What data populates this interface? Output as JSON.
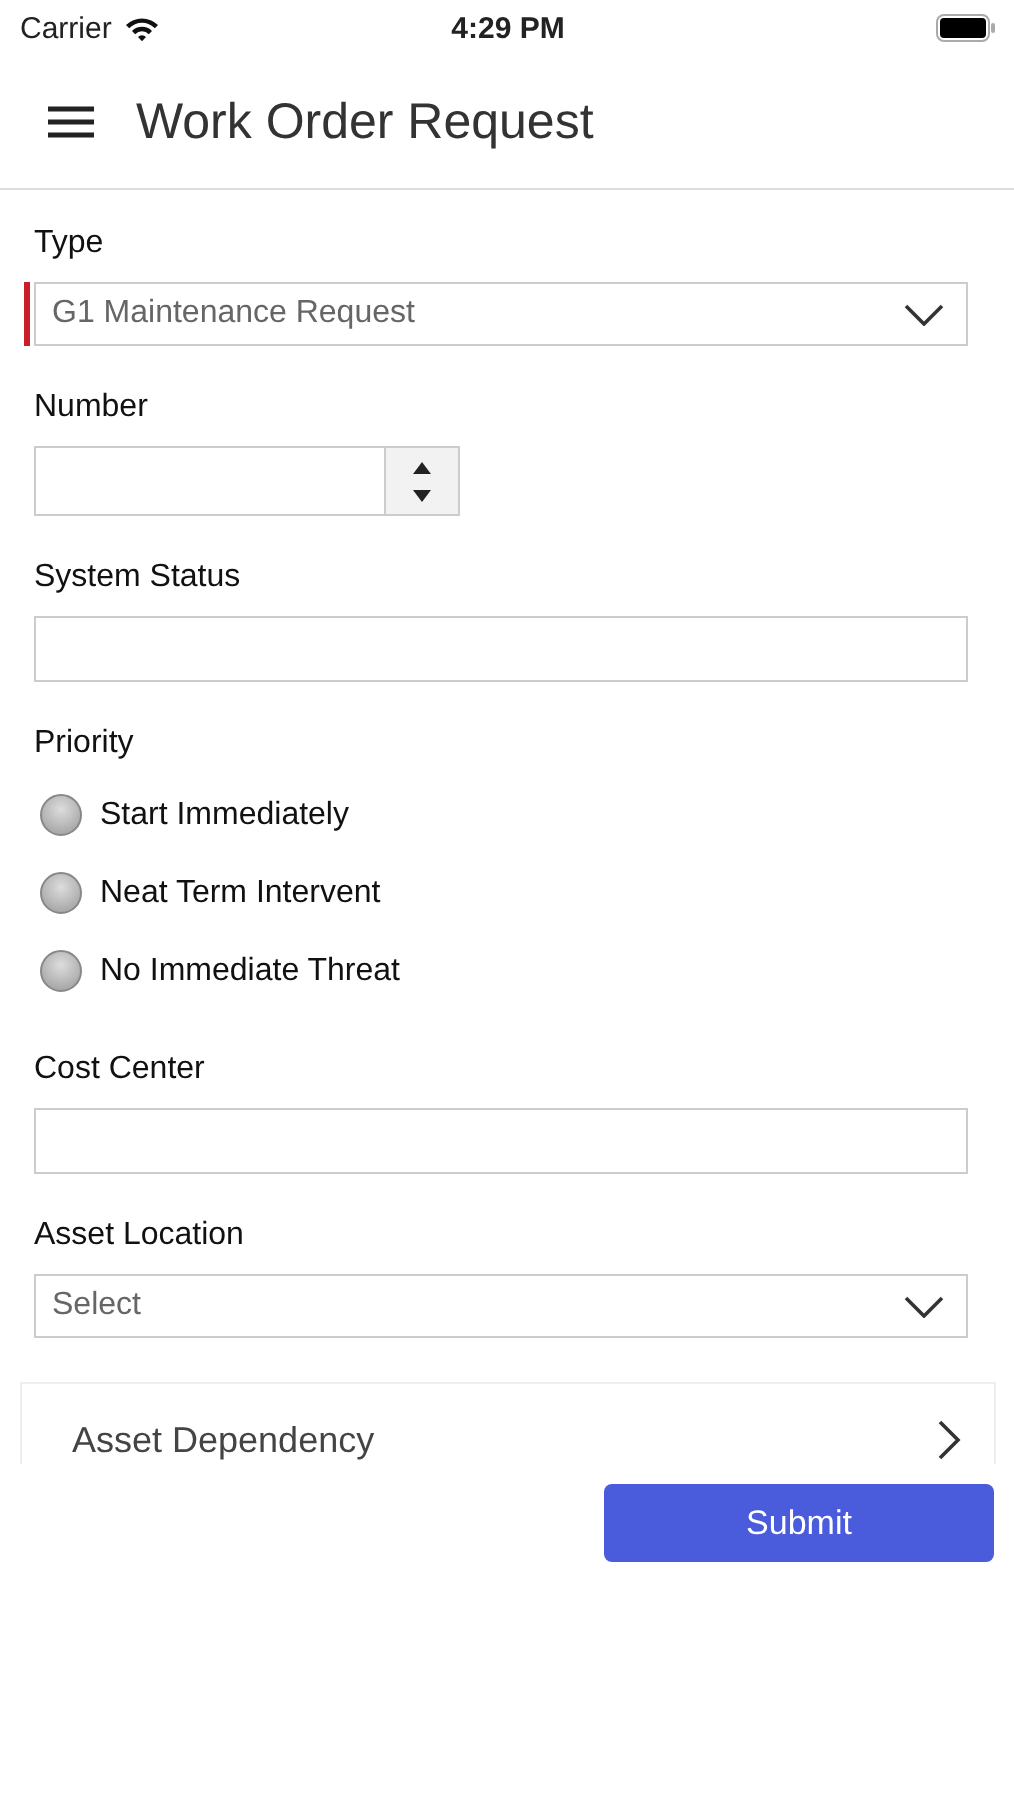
{
  "status_bar": {
    "carrier": "Carrier",
    "time": "4:29 PM"
  },
  "header": {
    "title": "Work Order Request"
  },
  "fields": [
    {
      "kind": "select",
      "label": "Type",
      "value": "G1 Maintenance Request",
      "required": true
    },
    {
      "kind": "number",
      "label": "Number"
    },
    {
      "kind": "text",
      "label": "System Status"
    },
    {
      "kind": "radio",
      "label": "Priority",
      "options": [
        {
          "label": "Start Immediately",
          "selected": false
        },
        {
          "label": "Neat Term Intervent",
          "selected": false
        },
        {
          "label": "No Immediate Threat",
          "selected": false
        }
      ]
    },
    {
      "kind": "text",
      "label": "Cost Center"
    },
    {
      "kind": "select",
      "label": "Asset Location",
      "value": "Select",
      "required": false
    }
  ],
  "nav_row": {
    "label": "Asset Dependency"
  },
  "submit": {
    "label": "Submit"
  }
}
